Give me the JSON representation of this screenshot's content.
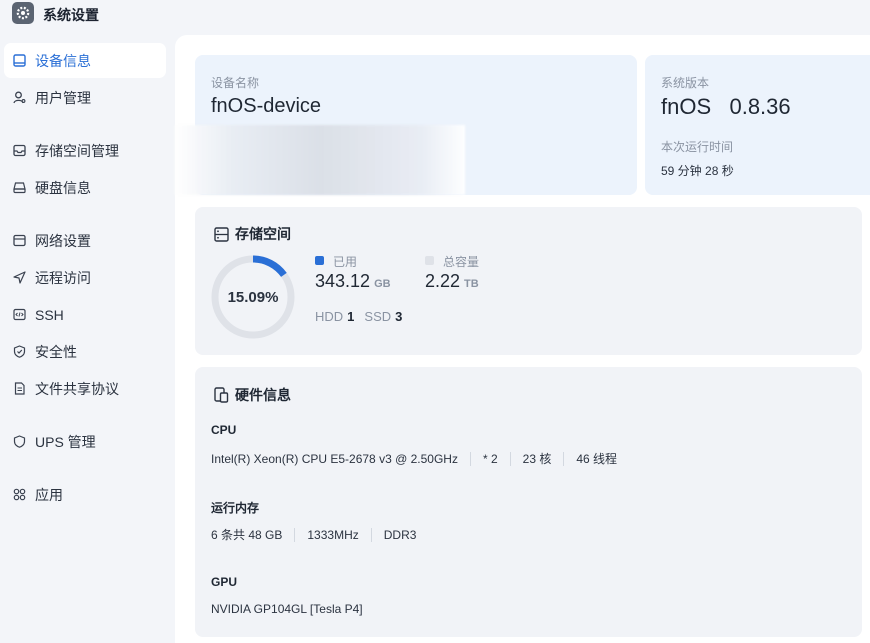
{
  "app": {
    "title": "系统设置"
  },
  "sidebar": {
    "items": [
      {
        "label": "设备信息"
      },
      {
        "label": "用户管理"
      },
      {
        "label": "存储空间管理"
      },
      {
        "label": "硬盘信息"
      },
      {
        "label": "网络设置"
      },
      {
        "label": "远程访问"
      },
      {
        "label": "SSH"
      },
      {
        "label": "安全性"
      },
      {
        "label": "文件共享协议"
      },
      {
        "label": "UPS 管理"
      },
      {
        "label": "应用"
      }
    ]
  },
  "device": {
    "name_label": "设备名称",
    "name": "fnOS-device"
  },
  "system": {
    "version_label": "系统版本",
    "version": "fnOS   0.8.36",
    "uptime_label": "本次运行时间",
    "uptime": "59 分钟 28 秒"
  },
  "storage": {
    "title": "存储空间",
    "percent_text": "15.09%",
    "used_fraction": 0.1509,
    "used_label": "已用",
    "used_value": "343.12",
    "used_unit": "GB",
    "total_label": "总容量",
    "total_value": "2.22",
    "total_unit": "TB",
    "hdd_label": "HDD",
    "hdd_count": "1",
    "ssd_label": "SSD",
    "ssd_count": "3",
    "colors": {
      "used": "#2a6fd6",
      "free": "#dfe2e8"
    }
  },
  "hardware": {
    "title": "硬件信息",
    "cpu_label": "CPU",
    "cpu_model": "Intel(R) Xeon(R) CPU E5-2678 v3 @ 2.50GHz",
    "cpu_count": "* 2",
    "cpu_cores": "23 核",
    "cpu_threads": "46 线程",
    "mem_label": "运行内存",
    "mem_size": "6 条共 48 GB",
    "mem_speed": "1333MHz",
    "mem_type": "DDR3",
    "gpu_label": "GPU",
    "gpu_model": "NVIDIA GP104GL [Tesla P4]"
  }
}
